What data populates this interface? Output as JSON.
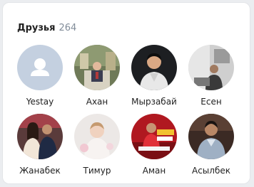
{
  "friends_widget": {
    "title": "Друзья",
    "count": "264",
    "friends": [
      {
        "name": "Yestay",
        "avatar": "default-person-icon"
      },
      {
        "name": "Ахан",
        "avatar": "photo"
      },
      {
        "name": "Мырзабай",
        "avatar": "photo"
      },
      {
        "name": "Есен",
        "avatar": "photo"
      },
      {
        "name": "Жанабек",
        "avatar": "photo"
      },
      {
        "name": "Тимур",
        "avatar": "photo"
      },
      {
        "name": "Аман",
        "avatar": "photo"
      },
      {
        "name": "Асылбек",
        "avatar": "photo"
      }
    ]
  },
  "colors": {
    "background": "#ebedf0",
    "card": "#ffffff",
    "text": "#222222",
    "muted": "#818c99",
    "placeholder_avatar": "#c4d0e0"
  }
}
